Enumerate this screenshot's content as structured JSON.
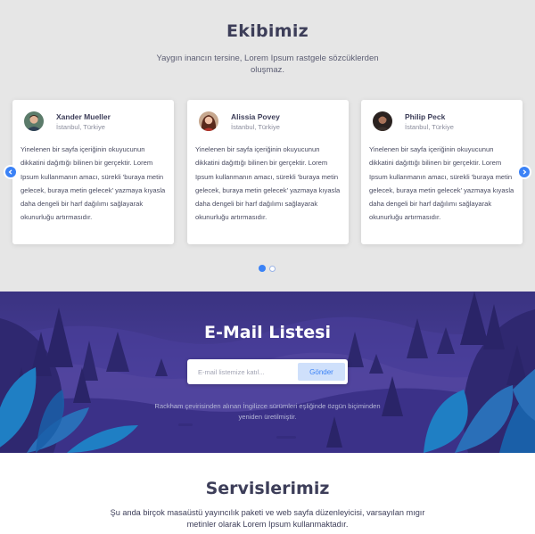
{
  "team": {
    "title": "Ekibimiz",
    "subtitle": "Yaygın inancın tersine, Lorem Ipsum rastgele sözcüklerden oluşmaz.",
    "members": [
      {
        "name": "Xander Mueller",
        "location": "İstanbul, Türkiye",
        "text": "Yinelenen bir sayfa içeriğinin okuyucunun dikkatini dağıttığı bilinen bir gerçektir. Lorem Ipsum kullanmanın amacı, sürekli 'buraya metin gelecek, buraya metin gelecek' yazmaya kıyasla daha dengeli bir harf dağılımı sağlayarak okunurluğu artırmasıdır."
      },
      {
        "name": "Alissia Povey",
        "location": "İstanbul, Türkiye",
        "text": "Yinelenen bir sayfa içeriğinin okuyucunun dikkatini dağıttığı bilinen bir gerçektir. Lorem Ipsum kullanmanın amacı, sürekli 'buraya metin gelecek, buraya metin gelecek' yazmaya kıyasla daha dengeli bir harf dağılımı sağlayarak okunurluğu artırmasıdır."
      },
      {
        "name": "Philip Peck",
        "location": "İstanbul, Türkiye",
        "text": "Yinelenen bir sayfa içeriğinin okuyucunun dikkatini dağıttığı bilinen bir gerçektir. Lorem Ipsum kullanmanın amacı, sürekli 'buraya metin gelecek, buraya metin gelecek' yazmaya kıyasla daha dengeli bir harf dağılımı sağlayarak okunurluğu artırmasıdır."
      }
    ],
    "carousel": {
      "prev_icon": "chevron-left-icon",
      "next_icon": "chevron-right-icon",
      "page_count": 2,
      "active_page": 1
    }
  },
  "newsletter": {
    "title": "E-Mail Listesi",
    "input_placeholder": "E-mail listemize katıl...",
    "button_label": "Gönder",
    "note": "Rackham çevirisinden alınan İngilizce sürümleri eşliğinde özgün biçiminden yeniden üretilmiştir."
  },
  "services": {
    "title": "Servislerimiz",
    "subtitle": "Şu anda birçok masaüstü yayıncılık paketi ve web sayfa düzenleyicisi, varsayılan mıgır metinler olarak Lorem Ipsum kullanmaktadır."
  },
  "colors": {
    "accent": "#3b82f6",
    "heading": "#3d3e59",
    "team_bg": "#e6e6e6",
    "newsletter_bg": "#3a3080",
    "leaf_blue": "#1f7fc4"
  }
}
